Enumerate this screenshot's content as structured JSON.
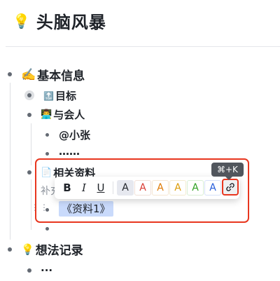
{
  "page": {
    "title": "头脑风暴",
    "title_icon": "lightbulb-icon"
  },
  "outline": {
    "basic_info": {
      "emoji": "✍️",
      "label": "基本信息"
    },
    "goal": {
      "emoji": "🔝",
      "label": "目标"
    },
    "attendees": {
      "emoji": "👨‍💻",
      "label": "与会人"
    },
    "attendee_1": "@小张",
    "attendee_more": "……",
    "materials": {
      "emoji": "📄",
      "label": "相关资料"
    },
    "materials_hint": "补充",
    "material_link": "《资料1》",
    "ideas": {
      "emoji": "💡",
      "label": "想法记录"
    },
    "ideas_more": "..."
  },
  "toolbar": {
    "bold": "B",
    "italic": "I",
    "underline": "U",
    "text_colors": [
      {
        "label": "A",
        "color": "#1f2329",
        "bg": "#e6e8ef"
      },
      {
        "label": "A",
        "color": "#d83931",
        "bg": "#ffffff"
      },
      {
        "label": "A",
        "color": "#de7802",
        "bg": "#ffffff"
      },
      {
        "label": "A",
        "color": "#dc9b04",
        "bg": "#ffffff"
      },
      {
        "label": "A",
        "color": "#2ea121",
        "bg": "#ffffff"
      },
      {
        "label": "A",
        "color": "#245bdb",
        "bg": "#ffffff"
      }
    ],
    "link_icon": "link-icon",
    "shortcut_tooltip": "⌘+K"
  },
  "colors": {
    "annotation_red": "#e8361f",
    "highlight_blue": "#c9dafb"
  }
}
